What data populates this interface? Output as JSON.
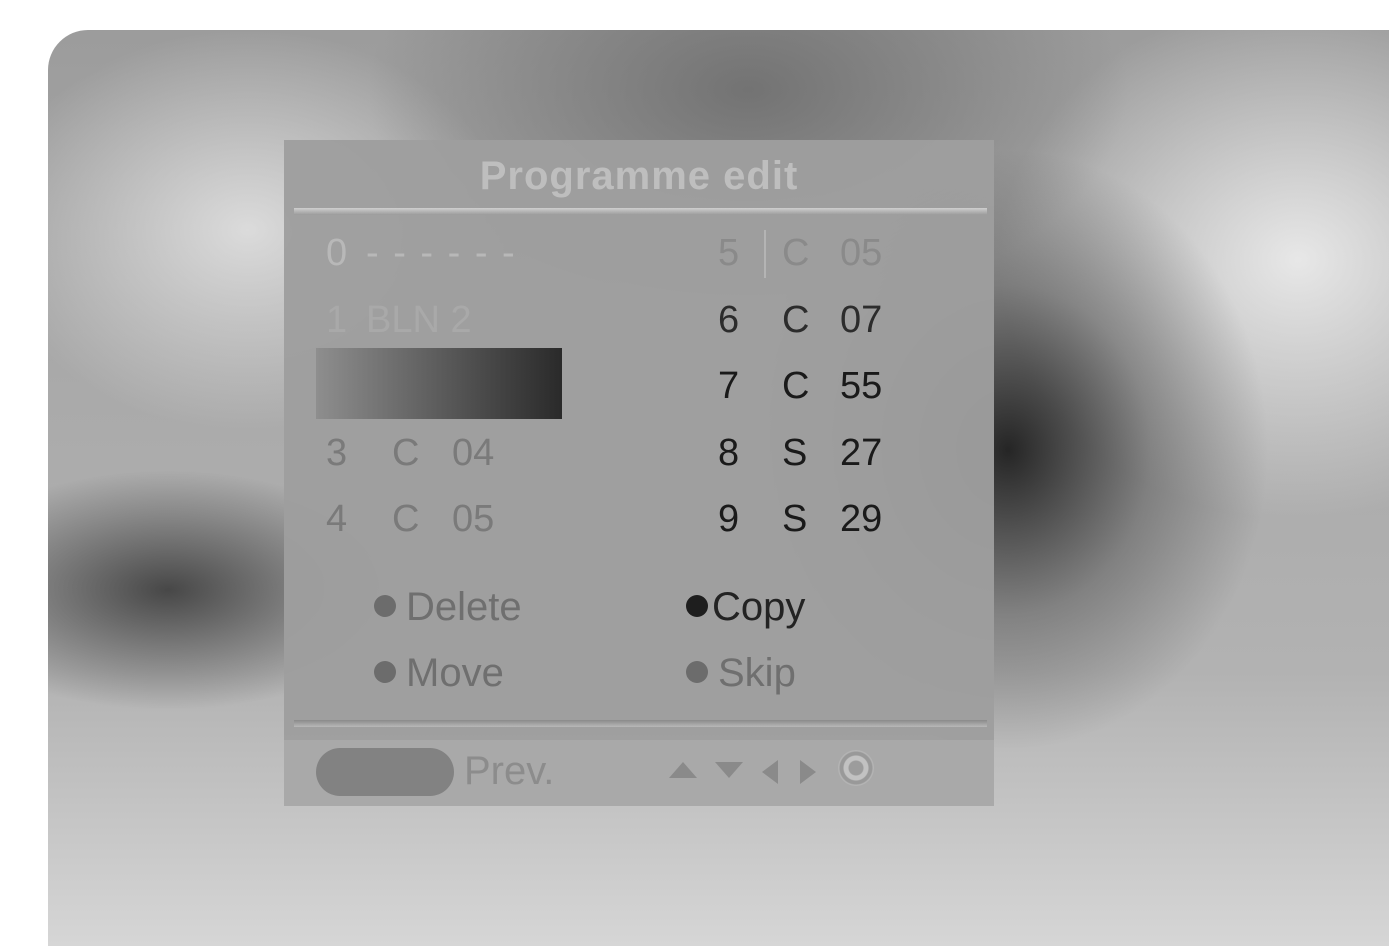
{
  "menu": {
    "title": "Programme edit",
    "left_rows": [
      {
        "num": "0",
        "label": "- - - - - -"
      },
      {
        "num": "1",
        "label": "BLN 2"
      },
      {
        "num": "",
        "label": ""
      },
      {
        "num": "3",
        "band": "C",
        "ch": "04"
      },
      {
        "num": "4",
        "band": "C",
        "ch": "05"
      }
    ],
    "right_rows": [
      {
        "num": "5",
        "band": "C",
        "ch": "05"
      },
      {
        "num": "6",
        "band": "C",
        "ch": "07"
      },
      {
        "num": "7",
        "band": "C",
        "ch": "55"
      },
      {
        "num": "8",
        "band": "S",
        "ch": "27"
      },
      {
        "num": "9",
        "band": "S",
        "ch": "29"
      }
    ],
    "options": {
      "delete": "Delete",
      "copy": "Copy",
      "move": "Move",
      "skip": "Skip"
    },
    "footer": {
      "prev": "Prev.",
      "nav_icons": [
        "up-arrow-icon",
        "down-arrow-icon",
        "left-arrow-icon",
        "right-arrow-icon",
        "ok-icon"
      ]
    }
  },
  "colors": {
    "panel": "#9e9e9e",
    "highlight_start": "#8e8e8e",
    "highlight_end": "#2a2a2a",
    "dot": "#6c6c6c",
    "dot_active": "#1e1e1e"
  }
}
